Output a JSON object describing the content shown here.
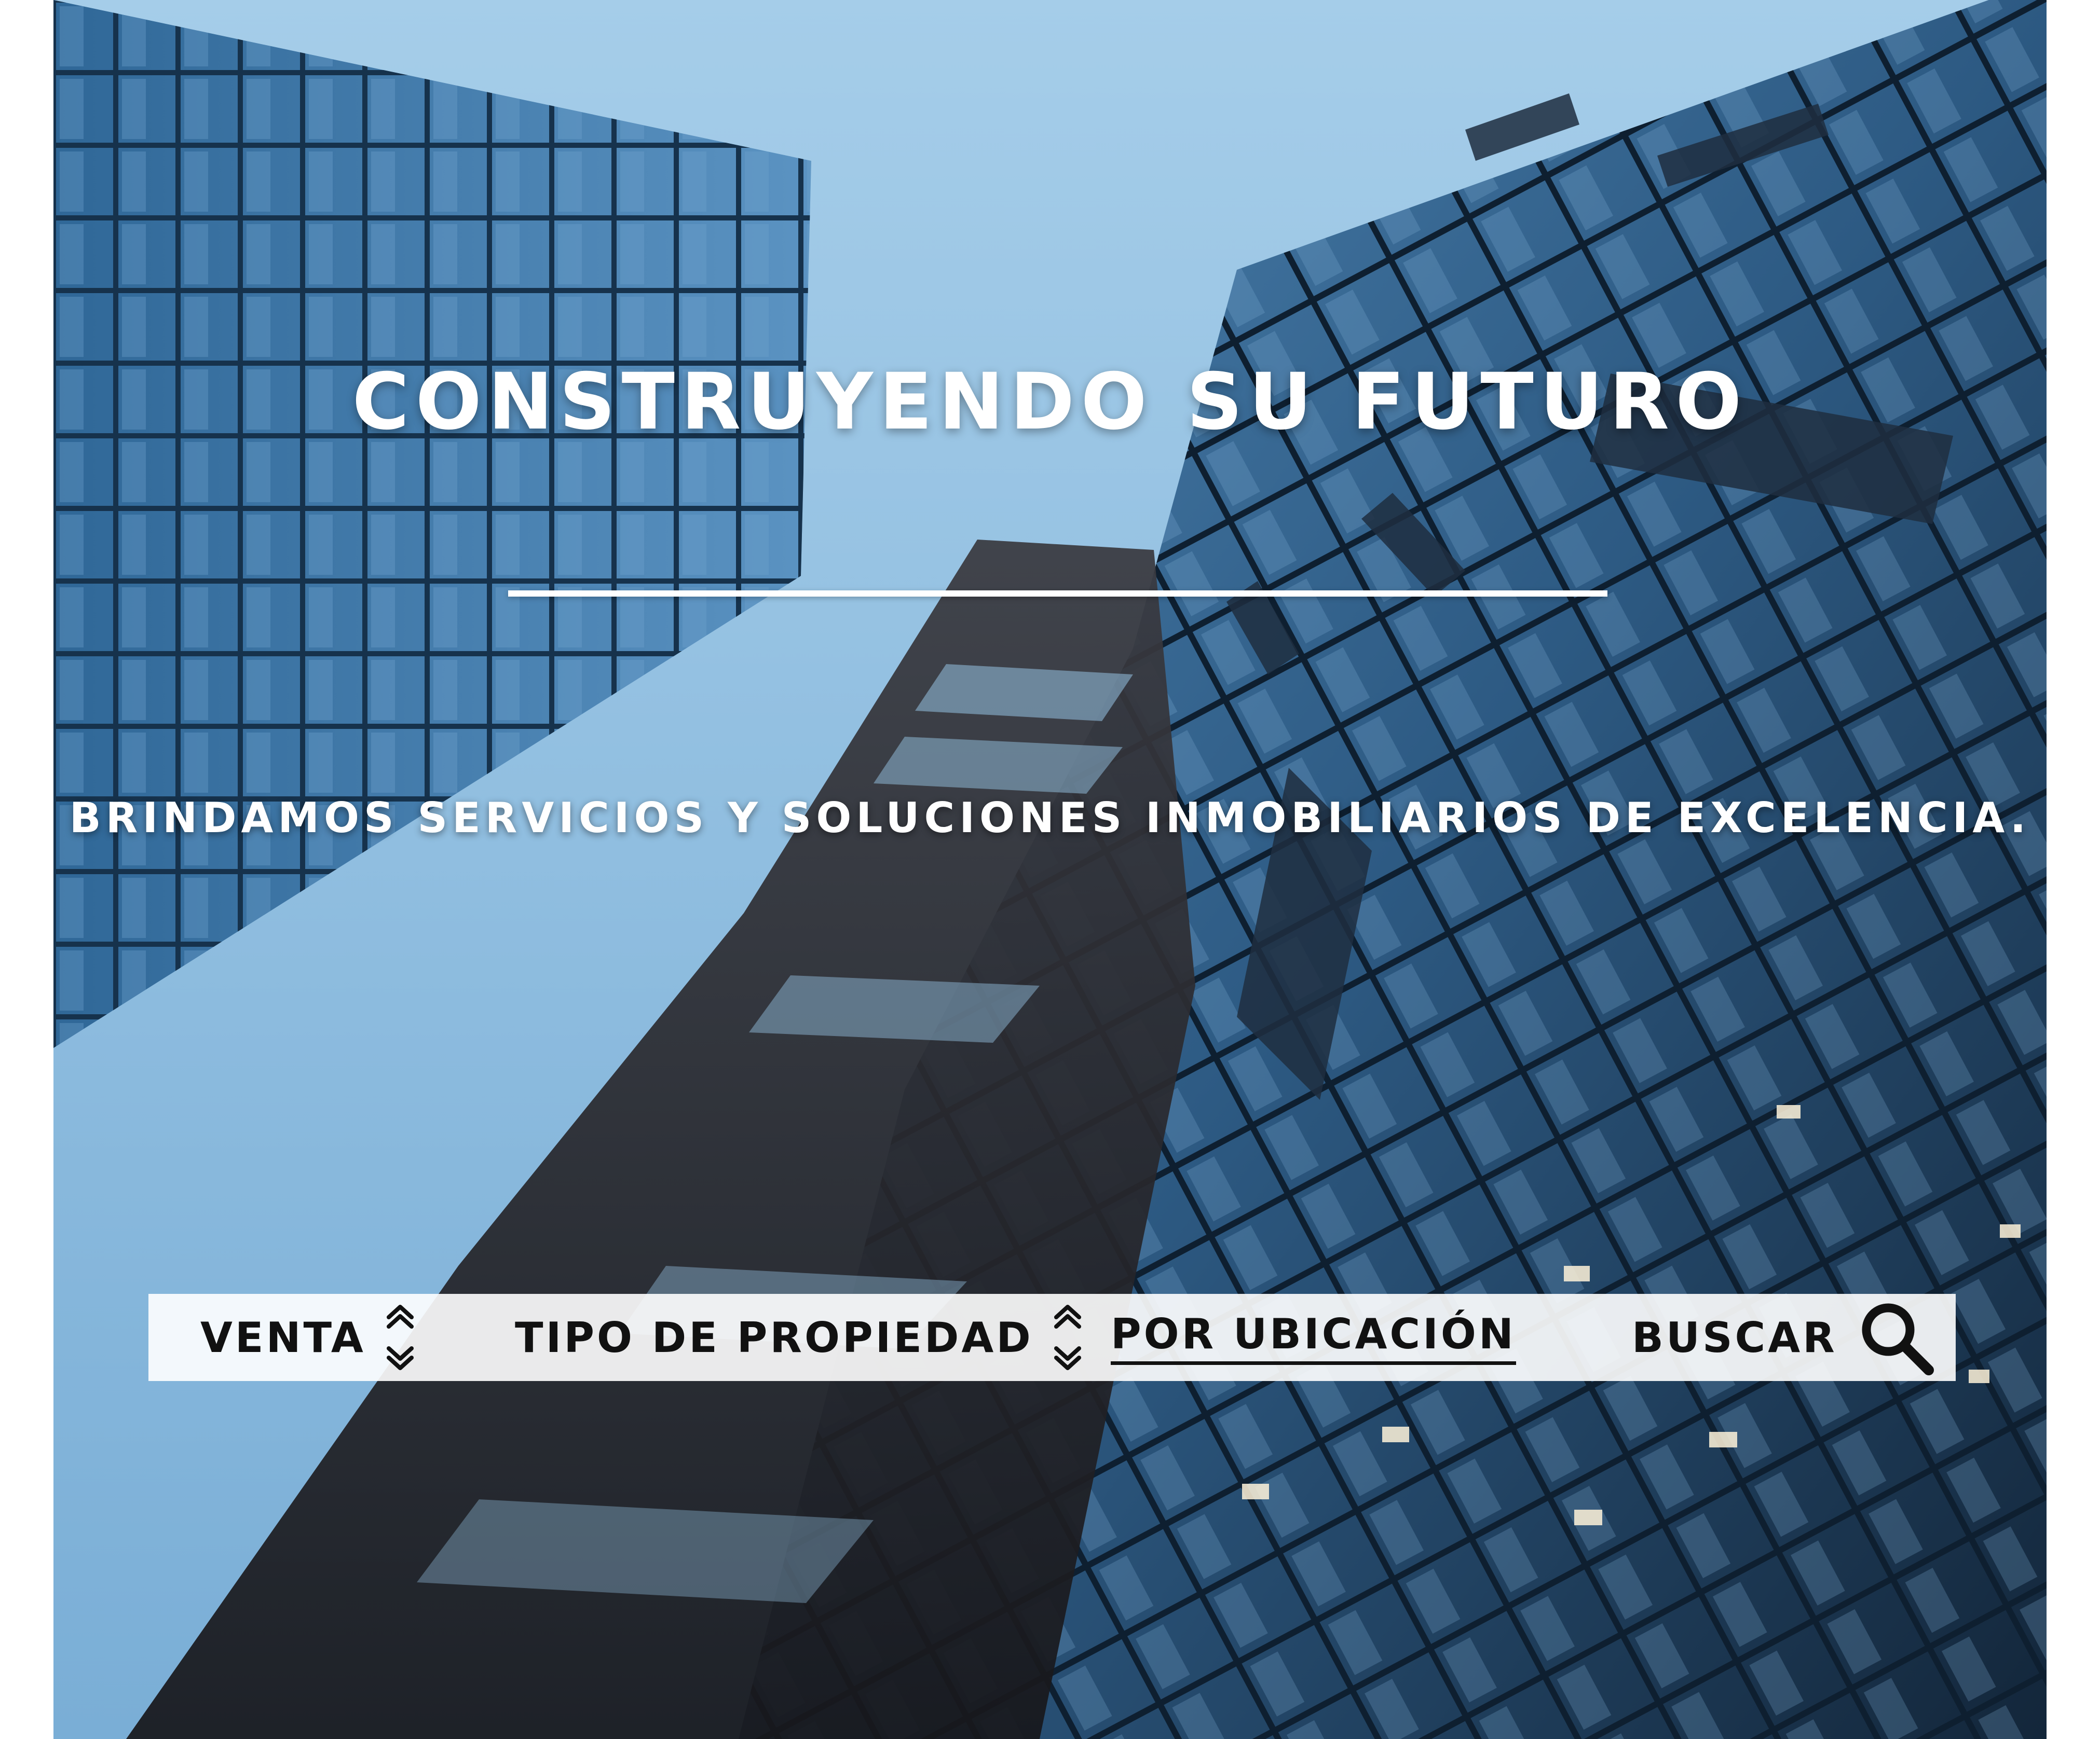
{
  "hero": {
    "headline": "CONSTRUYENDO SU FUTURO",
    "subheadline": "BRINDAMOS SERVICIOS Y SOLUCIONES INMOBILIARIOS DE EXCELENCIA.",
    "background_image": "low-angle-glass-skyscrapers"
  },
  "search_bar": {
    "operation": {
      "label": "VENTA",
      "icon": "up-down-chevron-icon"
    },
    "property_type": {
      "label": "TIPO DE PROPIEDAD",
      "icon": "up-down-chevron-icon"
    },
    "location": {
      "label": "POR UBICACIÓN"
    },
    "search": {
      "label": "BUSCAR",
      "icon": "search-icon"
    }
  },
  "colors": {
    "sky": "#9cc6e4",
    "glass": "#3d6f99",
    "text_light": "#ffffff",
    "text_dark": "#111111",
    "bar_background": "#ffffff"
  }
}
